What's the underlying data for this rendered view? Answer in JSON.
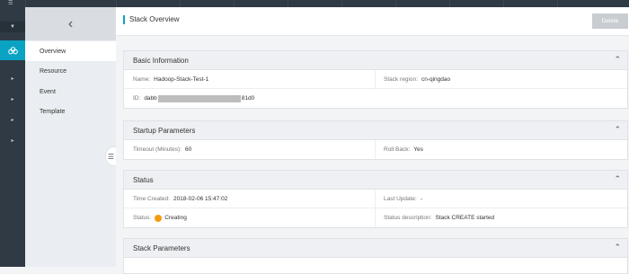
{
  "topbar": {
    "menu_icon": "hamburger-icon"
  },
  "rail": {
    "items": [
      "collapse",
      "cloud",
      "expand",
      "expand",
      "expand",
      "expand"
    ]
  },
  "subnav": {
    "items": [
      {
        "label": "Overview"
      },
      {
        "label": "Resource"
      },
      {
        "label": "Event"
      },
      {
        "label": "Template"
      }
    ]
  },
  "header": {
    "title": "Stack Overview",
    "delete_label": "Delete"
  },
  "basic": {
    "title": "Basic Information",
    "name_label": "Name:",
    "name_value": "Hadoop-Stack-Test-1",
    "region_label": "Stack region:",
    "region_value": "cn-qingdao",
    "id_label": "ID:",
    "id_prefix": "dabb",
    "id_suffix": "81d0"
  },
  "startup": {
    "title": "Startup Parameters",
    "timeout_label": "Timeout (Minutes):",
    "timeout_value": "60",
    "rollback_label": "Roll Back:",
    "rollback_value": "Yes"
  },
  "status": {
    "title": "Status",
    "created_label": "Time Created:",
    "created_value": "2018-02-06 15:47:02",
    "updated_label": "Last Update:",
    "updated_value": "-",
    "status_label": "Status:",
    "status_value": "Creating",
    "desc_label": "Status description:",
    "desc_value": "Stack CREATE started",
    "status_color": "#f39c12"
  },
  "params": {
    "title": "Stack Parameters"
  }
}
